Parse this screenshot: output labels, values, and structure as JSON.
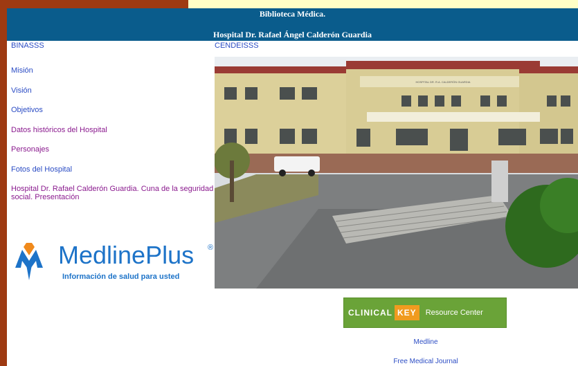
{
  "banner": {
    "line1": "Biblioteca Médica.",
    "line2": "Hospital Dr. Rafael Ángel Calderón Guardia"
  },
  "left": {
    "heading": "BINASSS",
    "links": [
      {
        "label": "Misión"
      },
      {
        "label": "Visión"
      },
      {
        "label": "Objetivos"
      },
      {
        "label": "Datos históricos del Hospital"
      },
      {
        "label": "Personajes"
      },
      {
        "label": "Fotos del Hospital"
      },
      {
        "label": "Hospital Dr. Rafael Calderón Guardia. Cuna de la seguridad social. Presentación"
      }
    ]
  },
  "right": {
    "heading": "CENDEISSS",
    "photo_sign": "HOSPITAL DR. R.A. CALDERÓN GUARDIA",
    "clinical_key": {
      "part1": "CLINICAL",
      "part2": "KEY",
      "part3": "Resource Center"
    },
    "links": [
      {
        "label": "Medline"
      },
      {
        "label": "Free Medical Journal"
      }
    ]
  },
  "medline": {
    "brand": "MedlinePlus",
    "reg": "®",
    "tagline": "Información de salud para usted"
  },
  "colors": {
    "frame": "#9e3a12",
    "banner": "#0a5c8c",
    "link_blue": "#2b4cc4",
    "link_purple": "#8a1a8e",
    "medline_blue": "#1d73c8",
    "medline_orange": "#f08a1c",
    "clinical_green": "#6aa338",
    "clinical_orange": "#f09b1f"
  }
}
